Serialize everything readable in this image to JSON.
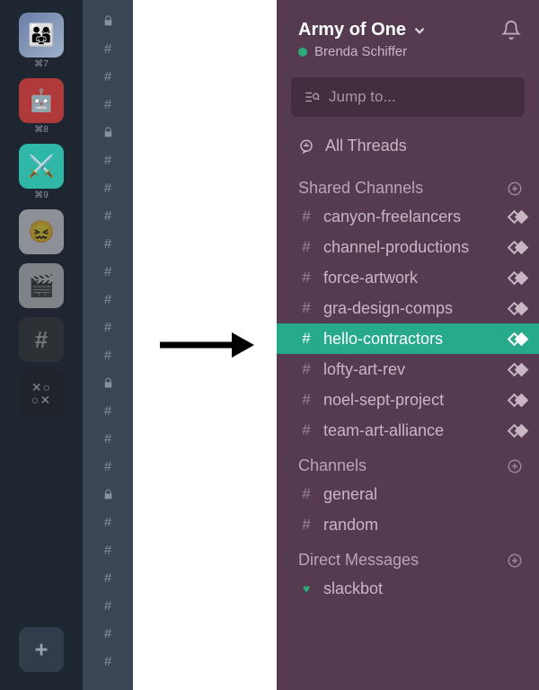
{
  "workspaces": [
    {
      "shortcut": "⌘7",
      "bg": "linear-gradient(135deg,#6a7ea8,#9fb1c9)",
      "emoji": "👨‍👩‍👧"
    },
    {
      "shortcut": "⌘8",
      "bg": "#b03a3a",
      "emoji": "🤖"
    },
    {
      "shortcut": "⌘9",
      "bg": "#2fb8a8",
      "emoji": "⚔️"
    },
    {
      "shortcut": "",
      "bg": "#e8e8e8",
      "emoji": "😖"
    },
    {
      "shortcut": "",
      "bg": "#cfcfcf",
      "emoji": "🎬"
    },
    {
      "shortcut": "",
      "bg": "#3a3a3a",
      "emoji": "#"
    },
    {
      "shortcut": "",
      "bg": "#222",
      "emoji": "⨯○"
    }
  ],
  "mini_icons": [
    "🔒",
    "#",
    "#",
    "#",
    "🔒",
    "#",
    "#",
    "#",
    "#",
    "#",
    "#",
    "#",
    "#",
    "🔒",
    "#",
    "#",
    "#",
    "🔒",
    "#",
    "#",
    "#",
    "#",
    "#",
    "#"
  ],
  "sidebar": {
    "workspace_name": "Army of One",
    "user_name": "Brenda Schiffer",
    "jump_placeholder": "Jump to...",
    "all_threads": "All Threads",
    "sections": {
      "shared": {
        "title": "Shared Channels",
        "items": [
          "canyon-freelancers",
          "channel-productions",
          "force-artwork",
          "gra-design-comps",
          "hello-contractors",
          "lofty-art-rev",
          "noel-sept-project",
          "team-art-alliance"
        ],
        "active_index": 4
      },
      "channels": {
        "title": "Channels",
        "items": [
          "general",
          "random"
        ]
      },
      "dms": {
        "title": "Direct Messages",
        "items": [
          "slackbot"
        ]
      }
    }
  }
}
